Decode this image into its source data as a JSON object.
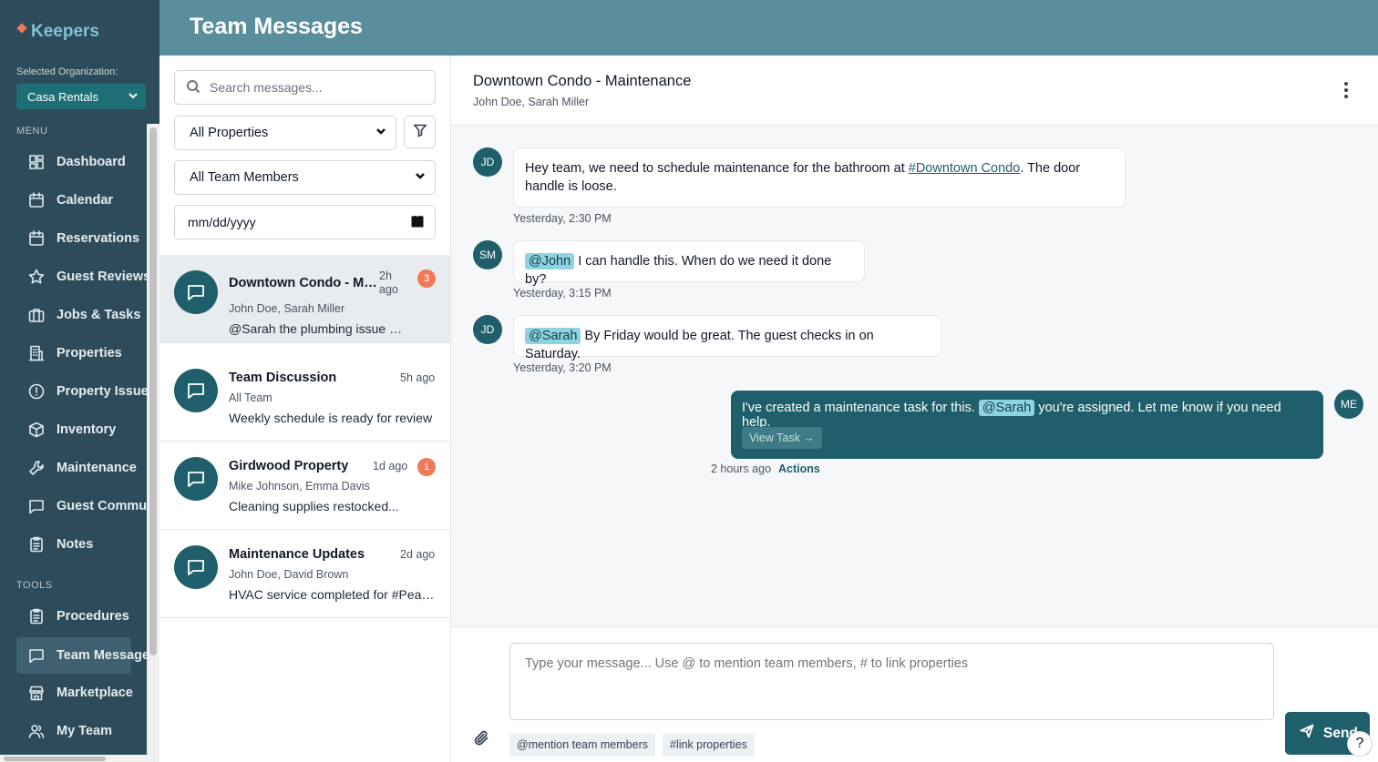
{
  "app": {
    "brand": "Keepers",
    "org_label": "Selected Organization:",
    "org_value": "Casa Rentals"
  },
  "sidebar": {
    "menu_label": "MENU",
    "tools_label": "TOOLS",
    "menu_items": [
      {
        "label": "Dashboard",
        "icon": "dashboard-icon"
      },
      {
        "label": "Calendar",
        "icon": "calendar-icon"
      },
      {
        "label": "Reservations",
        "icon": "calendar-icon"
      },
      {
        "label": "Guest Reviews",
        "icon": "star-icon"
      },
      {
        "label": "Jobs & Tasks",
        "icon": "briefcase-icon"
      },
      {
        "label": "Properties",
        "icon": "building-icon"
      },
      {
        "label": "Property Issues",
        "icon": "alert-circle-icon"
      },
      {
        "label": "Inventory",
        "icon": "box-icon"
      },
      {
        "label": "Maintenance",
        "icon": "wrench-icon"
      },
      {
        "label": "Guest Communication",
        "icon": "message-icon"
      },
      {
        "label": "Notes",
        "icon": "clipboard-icon"
      }
    ],
    "tool_items": [
      {
        "label": "Procedures",
        "icon": "clipboard-icon"
      },
      {
        "label": "Team Messages",
        "icon": "message-icon",
        "active": true
      },
      {
        "label": "Marketplace",
        "icon": "store-icon"
      },
      {
        "label": "My Team",
        "icon": "users-icon"
      }
    ]
  },
  "header": {
    "title": "Team Messages"
  },
  "filters": {
    "search_placeholder": "Search messages...",
    "property_select": "All Properties",
    "member_select": "All Team Members",
    "date_placeholder": "mm/dd/yyyy"
  },
  "conversations": [
    {
      "title": "Downtown Condo - Maintenance",
      "time": "2h ago",
      "badge": "3",
      "members": "John Doe, Sarah Miller",
      "preview": "@Sarah the plumbing issue has been resolved"
    },
    {
      "title": "Team Discussion",
      "time": "5h ago",
      "badge": "",
      "members": "All Team",
      "preview": "Weekly schedule is ready for review"
    },
    {
      "title": "Girdwood Property",
      "time": "1d ago",
      "badge": "1",
      "members": "Mike Johnson, Emma Davis",
      "preview": "Cleaning supplies restocked..."
    },
    {
      "title": "Maintenance Updates",
      "time": "2d ago",
      "badge": "",
      "members": "John Doe, David Brown",
      "preview": "HVAC service completed for #Peak View"
    }
  ],
  "chat": {
    "title": "Downtown Condo - Maintenance",
    "members": "John Doe, Sarah Miller",
    "messages": [
      {
        "avatar": "JD",
        "before": "Hey team, we need to schedule maintenance for the bathroom at ",
        "link": "#Downtown Condo",
        "after": ". The door handle is loose.",
        "time": "Yesterday, 2:30 PM"
      },
      {
        "avatar": "SM",
        "mention": "@John",
        "text": " I can handle this. When do we need it done by?",
        "time": "Yesterday, 3:15 PM"
      },
      {
        "avatar": "JD",
        "mention": "@Sarah",
        "text": " By Friday would be great. The guest checks in on Saturday.",
        "time": "Yesterday, 3:20 PM"
      }
    ],
    "my_message": {
      "avatar": "ME",
      "before": "I've created a maintenance task for this. ",
      "mention": "@Sarah",
      "after": " you're assigned. Let me know if you need help.",
      "button": "View Task →",
      "time": "2 hours ago",
      "actions": "Actions"
    }
  },
  "composer": {
    "placeholder": "Type your message... Use @ to mention team members, # to link properties",
    "chip_mention": "@mention team members",
    "chip_link": "#link properties",
    "send": "Send",
    "help": "?"
  },
  "colors": {
    "sidebar": "#2d4b5a",
    "header": "#5b8e9c",
    "accent": "#1f5f6b",
    "badge": "#f0795a",
    "mention": "#8fd3e0"
  }
}
